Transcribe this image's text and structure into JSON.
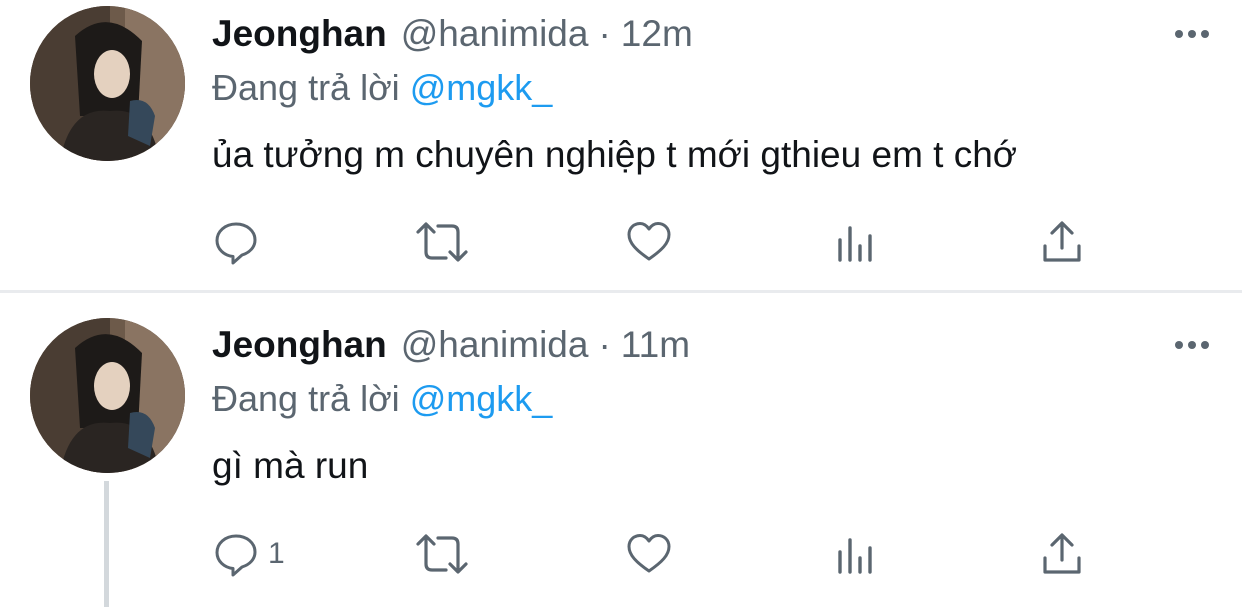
{
  "tweets": [
    {
      "name": "Jeonghan",
      "handle": "@hanimida",
      "separator": "·",
      "time": "12m",
      "reply_prefix": "Đang trả lời",
      "reply_to": "@mgkk_",
      "text": "ủa tưởng m chuyên nghiệp t mới gthieu em t chớ",
      "reply_count": ""
    },
    {
      "name": "Jeonghan",
      "handle": "@hanimida",
      "separator": "·",
      "time": "11m",
      "reply_prefix": "Đang trả lời",
      "reply_to": "@mgkk_",
      "text": "gì mà run",
      "reply_count": "1"
    }
  ],
  "icons": {
    "more": "more-horizontal-icon",
    "reply": "comment-icon",
    "retweet": "retweet-icon",
    "like": "heart-icon",
    "views": "analytics-icon",
    "share": "share-icon"
  },
  "colors": {
    "text_primary": "#111418",
    "text_secondary": "#5b6670",
    "mention": "#1d9bf0",
    "divider": "#e9ebee",
    "thread_line": "#d3d8dc"
  }
}
